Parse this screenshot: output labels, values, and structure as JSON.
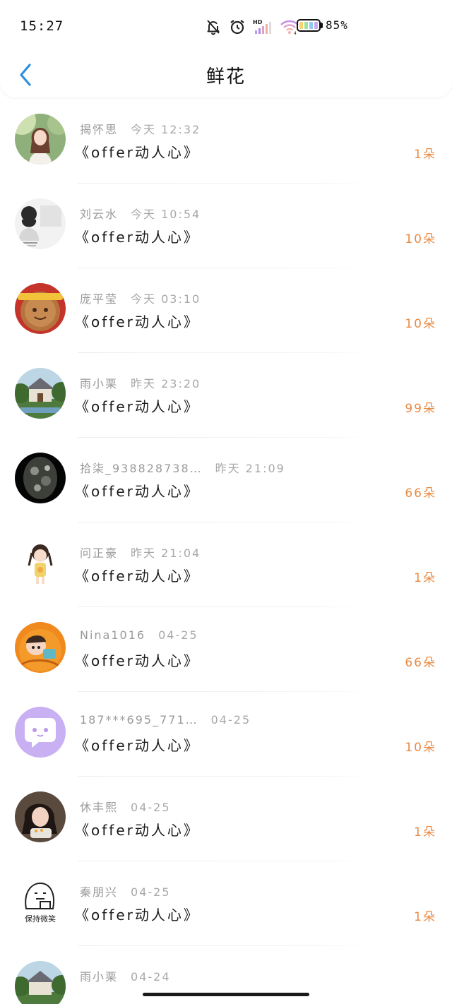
{
  "status_bar": {
    "time": "15:27",
    "battery_level": "85%",
    "icons": [
      "mute-bell-icon",
      "alarm-icon",
      "hd-signal-icon",
      "wifi-icon",
      "battery-icon"
    ]
  },
  "header": {
    "title": "鲜花",
    "back_icon": "chevron-left-icon"
  },
  "colors": {
    "accent_blue": "#2f8fde",
    "count_orange": "#e98a44",
    "meta_gray": "#9a9a9a"
  },
  "gifts": [
    {
      "name": "揭怀思",
      "time": "今天 12:32",
      "title": "《offer动人心》",
      "count": "1朵"
    },
    {
      "name": "刘云水",
      "time": "今天 10:54",
      "title": "《offer动人心》",
      "count": "10朵"
    },
    {
      "name": "庞平莹",
      "time": "今天 03:10",
      "title": "《offer动人心》",
      "count": "10朵"
    },
    {
      "name": "雨小栗",
      "time": "昨天 23:20",
      "title": "《offer动人心》",
      "count": "99朵"
    },
    {
      "name": "拾柒_938828738…",
      "time": "昨天 21:09",
      "title": "《offer动人心》",
      "count": "66朵"
    },
    {
      "name": "问正豪",
      "time": "昨天 21:04",
      "title": "《offer动人心》",
      "count": "1朵"
    },
    {
      "name": "Nina1016",
      "time": "04-25",
      "title": "《offer动人心》",
      "count": "66朵"
    },
    {
      "name": "187***695_771…",
      "time": "04-25",
      "title": "《offer动人心》",
      "count": "10朵"
    },
    {
      "name": "休丰熙",
      "time": "04-25",
      "title": "《offer动人心》",
      "count": "1朵"
    },
    {
      "name": "秦朋兴",
      "time": "04-25",
      "title": "《offer动人心》",
      "count": "1朵"
    },
    {
      "name": "雨小栗",
      "time": "04-24",
      "title": "",
      "count": ""
    }
  ],
  "avatar_texts": {
    "row6_sticker": "保持微笑"
  }
}
